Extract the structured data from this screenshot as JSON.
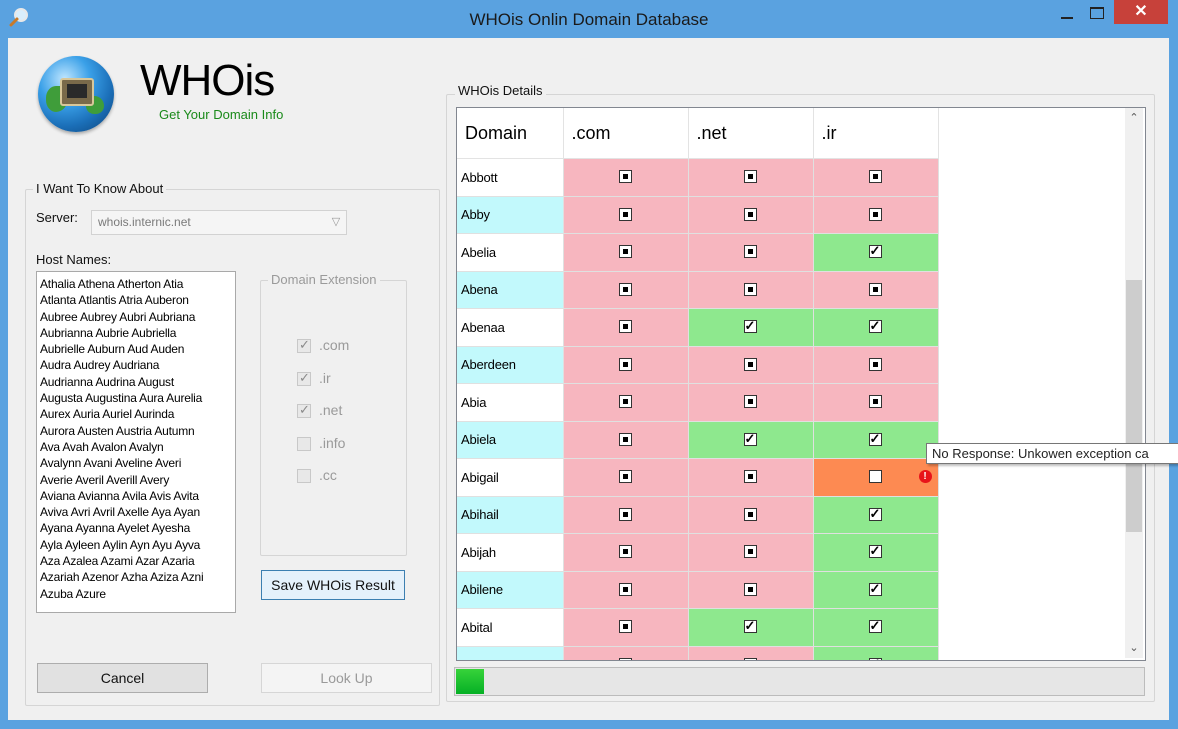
{
  "window": {
    "title": "WHOis  Onlin Domain Database",
    "close_label": "✕"
  },
  "header": {
    "brand": "WHOis",
    "tagline": "Get Your Domain Info"
  },
  "query": {
    "group_label": "I Want To Know About",
    "server_label": "Server:",
    "server_value": "whois.internic.net",
    "hostnames_label": "Host Names:",
    "hostnames": "Athalia Athena Atherton Atia\nAtlanta Atlantis Atria Auberon\nAubree Aubrey Aubri Aubriana\nAubrianna Aubrie Aubriella\nAubrielle Auburn Aud Auden\nAudra Audrey Audriana\nAudrianna Audrina August\nAugusta Augustina Aura Aurelia\nAurex Auria Auriel Aurinda\nAurora Austen Austria Autumn\nAva Avah Avalon Avalyn\nAvalynn Avani Aveline Averi\nAverie Averil Averill Avery\nAviana Avianna Avila Avis Avita\nAviva Avri Avril Axelle Aya Ayan\nAyana Ayanna Ayelet Ayesha\nAyla Ayleen Aylin Ayn Ayu Ayva\nAza Azalea Azami Azar Azaria\nAzariah Azenor Azha Aziza Azni\nAzuba Azure"
  },
  "extensions": {
    "group_label": "Domain Extension",
    "items": [
      {
        "label": ".com",
        "checked": true
      },
      {
        "label": ".ir",
        "checked": true
      },
      {
        "label": ".net",
        "checked": true
      },
      {
        "label": ".info",
        "checked": false
      },
      {
        "label": ".cc",
        "checked": false
      }
    ]
  },
  "buttons": {
    "save": "Save WHOis Result",
    "cancel": "Cancel",
    "lookup": "Look Up"
  },
  "details": {
    "group_label": "WHOis Details",
    "columns": [
      "Domain",
      ".com",
      ".net",
      ".ir"
    ],
    "rows": [
      {
        "name": "Abbott",
        "row_color": "white",
        "cells": [
          {
            "state": "taken",
            "color": "red"
          },
          {
            "state": "taken",
            "color": "red"
          },
          {
            "state": "taken",
            "color": "red"
          }
        ]
      },
      {
        "name": "Abby",
        "row_color": "cyan",
        "cells": [
          {
            "state": "taken",
            "color": "red"
          },
          {
            "state": "taken",
            "color": "red"
          },
          {
            "state": "taken",
            "color": "red"
          }
        ]
      },
      {
        "name": "Abelia",
        "row_color": "white",
        "cells": [
          {
            "state": "taken",
            "color": "red"
          },
          {
            "state": "taken",
            "color": "red"
          },
          {
            "state": "available",
            "color": "green"
          }
        ]
      },
      {
        "name": "Abena",
        "row_color": "cyan",
        "cells": [
          {
            "state": "taken",
            "color": "red"
          },
          {
            "state": "taken",
            "color": "red"
          },
          {
            "state": "taken",
            "color": "red"
          }
        ]
      },
      {
        "name": "Abenaa",
        "row_color": "white",
        "cells": [
          {
            "state": "taken",
            "color": "red"
          },
          {
            "state": "available",
            "color": "green"
          },
          {
            "state": "available",
            "color": "green"
          }
        ]
      },
      {
        "name": "Aberdeen",
        "row_color": "cyan",
        "cells": [
          {
            "state": "taken",
            "color": "red"
          },
          {
            "state": "taken",
            "color": "red"
          },
          {
            "state": "taken",
            "color": "red"
          }
        ]
      },
      {
        "name": "Abia",
        "row_color": "white",
        "cells": [
          {
            "state": "taken",
            "color": "red"
          },
          {
            "state": "taken",
            "color": "red"
          },
          {
            "state": "taken",
            "color": "red"
          }
        ]
      },
      {
        "name": "Abiela",
        "row_color": "cyan",
        "cells": [
          {
            "state": "taken",
            "color": "red"
          },
          {
            "state": "available",
            "color": "green"
          },
          {
            "state": "available",
            "color": "green"
          }
        ]
      },
      {
        "name": "Abigail",
        "row_color": "white",
        "cells": [
          {
            "state": "taken",
            "color": "red"
          },
          {
            "state": "taken",
            "color": "red"
          },
          {
            "state": "error",
            "color": "orange"
          }
        ]
      },
      {
        "name": "Abihail",
        "row_color": "cyan",
        "cells": [
          {
            "state": "taken",
            "color": "red"
          },
          {
            "state": "taken",
            "color": "red"
          },
          {
            "state": "available",
            "color": "green"
          }
        ]
      },
      {
        "name": "Abijah",
        "row_color": "white",
        "cells": [
          {
            "state": "taken",
            "color": "red"
          },
          {
            "state": "taken",
            "color": "red"
          },
          {
            "state": "available",
            "color": "green"
          }
        ]
      },
      {
        "name": "Abilene",
        "row_color": "cyan",
        "cells": [
          {
            "state": "taken",
            "color": "red"
          },
          {
            "state": "taken",
            "color": "red"
          },
          {
            "state": "available",
            "color": "green"
          }
        ]
      },
      {
        "name": "Abital",
        "row_color": "white",
        "cells": [
          {
            "state": "taken",
            "color": "red"
          },
          {
            "state": "available",
            "color": "green"
          },
          {
            "state": "available",
            "color": "green"
          }
        ]
      },
      {
        "name": "",
        "row_color": "cyan",
        "cells": [
          {
            "state": "taken",
            "color": "red"
          },
          {
            "state": "taken",
            "color": "red"
          },
          {
            "state": "available",
            "color": "green"
          }
        ]
      }
    ],
    "error_icon": "!",
    "tooltip": "No Response: Unkowen exception ca"
  },
  "scroll": {
    "up_glyph": "⌃",
    "down_glyph": "⌄"
  },
  "progress": {
    "value": 0.04
  },
  "colors": {
    "titlebar": "#5aa2e0",
    "close": "#c7413a",
    "taken": "#f7b6bf",
    "available": "#8ee88e",
    "error": "#fd8a52",
    "cyan_row": "#c2f9fc",
    "progress": "#06b025"
  }
}
